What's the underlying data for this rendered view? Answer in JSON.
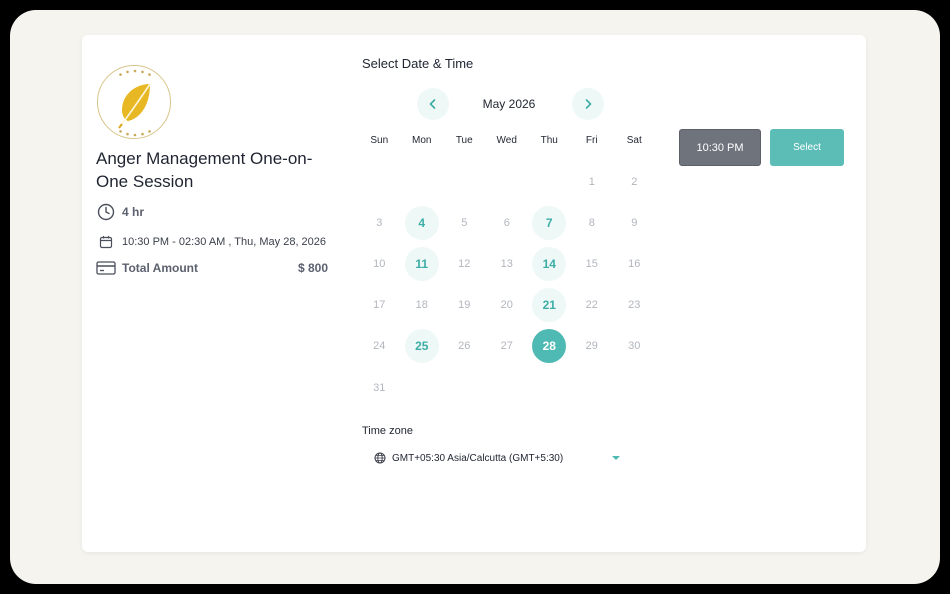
{
  "event": {
    "title": "Anger Management One-on-One Session",
    "duration": "4 hr",
    "datetime": "10:30 PM - 02:30 AM , Thu, May 28, 2026",
    "amount_label": "Total Amount",
    "amount_value": "$ 800"
  },
  "calendar": {
    "section_title": "Select Date & Time",
    "month": "May 2026",
    "weekdays": [
      "Sun",
      "Mon",
      "Tue",
      "Wed",
      "Thu",
      "Fri",
      "Sat"
    ],
    "leading_blanks": 5,
    "days": [
      {
        "n": "1",
        "state": "disabled"
      },
      {
        "n": "2",
        "state": "disabled"
      },
      {
        "n": "3",
        "state": "disabled"
      },
      {
        "n": "4",
        "state": "available"
      },
      {
        "n": "5",
        "state": "disabled"
      },
      {
        "n": "6",
        "state": "disabled"
      },
      {
        "n": "7",
        "state": "available"
      },
      {
        "n": "8",
        "state": "disabled"
      },
      {
        "n": "9",
        "state": "disabled"
      },
      {
        "n": "10",
        "state": "disabled"
      },
      {
        "n": "11",
        "state": "available"
      },
      {
        "n": "12",
        "state": "disabled"
      },
      {
        "n": "13",
        "state": "disabled"
      },
      {
        "n": "14",
        "state": "available"
      },
      {
        "n": "15",
        "state": "disabled"
      },
      {
        "n": "16",
        "state": "disabled"
      },
      {
        "n": "17",
        "state": "disabled"
      },
      {
        "n": "18",
        "state": "disabled"
      },
      {
        "n": "19",
        "state": "disabled"
      },
      {
        "n": "20",
        "state": "disabled"
      },
      {
        "n": "21",
        "state": "available"
      },
      {
        "n": "22",
        "state": "disabled"
      },
      {
        "n": "23",
        "state": "disabled"
      },
      {
        "n": "24",
        "state": "disabled"
      },
      {
        "n": "25",
        "state": "available"
      },
      {
        "n": "26",
        "state": "disabled"
      },
      {
        "n": "27",
        "state": "disabled"
      },
      {
        "n": "28",
        "state": "selected"
      },
      {
        "n": "29",
        "state": "disabled"
      },
      {
        "n": "30",
        "state": "disabled"
      },
      {
        "n": "31",
        "state": "disabled"
      }
    ]
  },
  "slots": {
    "time": "10:30 PM",
    "select_label": "Select"
  },
  "timezone": {
    "label": "Time zone",
    "value": "GMT+05:30 Asia/Calcutta (GMT+5:30)"
  },
  "colors": {
    "accent": "#4fb9b3",
    "accent_light": "#eef8f7",
    "slot_bg": "#6f737c",
    "logo_leaf": "#e8b824"
  },
  "icons": {
    "logo": "leaf-logo-icon",
    "duration": "clock-icon",
    "date": "calendar-icon",
    "amount": "credit-card-icon",
    "prev": "chevron-left-icon",
    "next": "chevron-right-icon",
    "timezone": "globe-icon",
    "dropdown": "caret-down-icon"
  }
}
